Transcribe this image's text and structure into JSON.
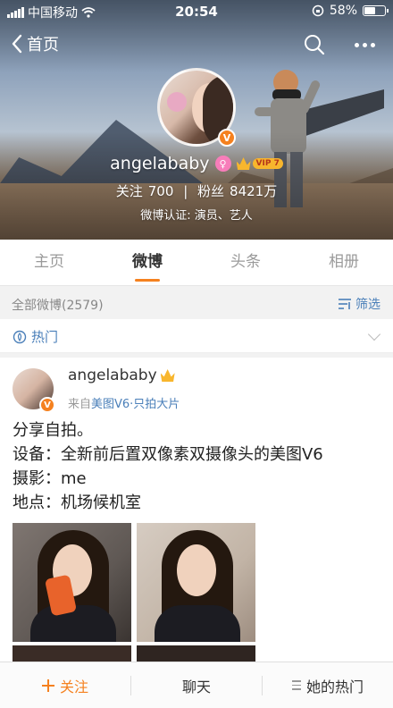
{
  "status_bar": {
    "carrier": "中国移动",
    "time": "20:54",
    "battery_percent": "58%",
    "battery_level": 0.58
  },
  "nav": {
    "back_label": "首页"
  },
  "profile": {
    "name": "angelababy",
    "vip_label": "VIP 7",
    "verified_badge": "V",
    "following_label": "关注",
    "following_count": "700",
    "followers_label": "粉丝",
    "followers_count": "8421万",
    "verification": "微博认证: 演员、艺人"
  },
  "tabs": [
    {
      "label": "主页",
      "active": false
    },
    {
      "label": "微博",
      "active": true
    },
    {
      "label": "头条",
      "active": false
    },
    {
      "label": "相册",
      "active": false
    }
  ],
  "filter_bar": {
    "count_label": "全部微博(2579)",
    "filter_label": "筛选"
  },
  "hot_bar": {
    "label": "热门"
  },
  "post": {
    "author": "angelababy",
    "source_prefix": "来自",
    "source_link": "美图V6·只拍大片",
    "lines": [
      "分享自拍。",
      "设备：全新前后置双像素双摄像头的美图V6",
      "摄影：me",
      "地点：机场候机室"
    ]
  },
  "bottom_bar": {
    "follow_label": "关注",
    "chat_label": "聊天",
    "her_hot_label": "她的热门"
  },
  "colors": {
    "accent": "#f5811f",
    "link": "#4a7fb9",
    "vip_gold": "#f8b62d"
  }
}
